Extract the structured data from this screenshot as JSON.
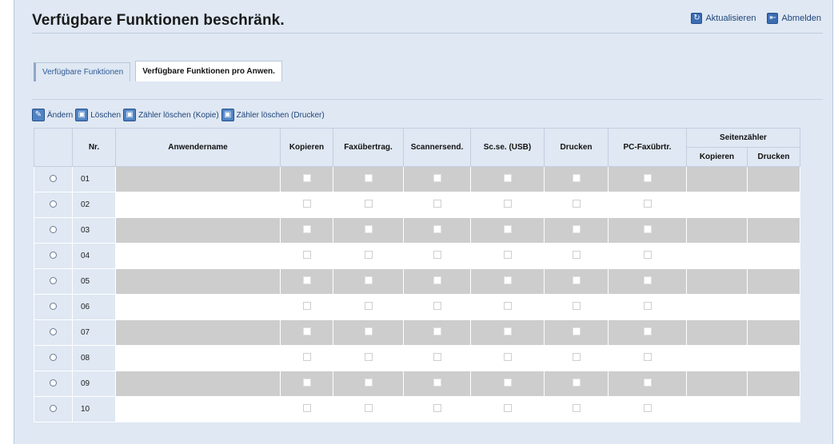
{
  "header": {
    "title": "Verfügbare Funktionen beschränk.",
    "refresh_label": "Aktualisieren",
    "logout_label": "Abmelden"
  },
  "tabs": [
    {
      "label": "Verfügbare Funktionen",
      "active": false
    },
    {
      "label": "Verfügbare Funktionen pro Anwen.",
      "active": true
    }
  ],
  "toolbar": {
    "edit_label": "Ändern",
    "delete_label": "Löschen",
    "clear_copy_label": "Zähler löschen (Kopie)",
    "clear_print_label": "Zähler löschen (Drucker)"
  },
  "table": {
    "headers": {
      "number": "Nr.",
      "user_name": "Anwendername",
      "copy": "Kopieren",
      "fax": "Faxübertrag.",
      "scanner": "Scannersend.",
      "scan_usb": "Sc.se. (USB)",
      "print": "Drucken",
      "pc_fax": "PC-Faxübrtr.",
      "page_counter": "Seitenzähler",
      "counter_copy": "Kopieren",
      "counter_print": "Drucken"
    },
    "rows": [
      {
        "number": "01"
      },
      {
        "number": "02"
      },
      {
        "number": "03"
      },
      {
        "number": "04"
      },
      {
        "number": "05"
      },
      {
        "number": "06"
      },
      {
        "number": "07"
      },
      {
        "number": "08"
      },
      {
        "number": "09"
      },
      {
        "number": "10"
      }
    ]
  },
  "colors": {
    "page_bg": "#dfe8f3",
    "row_shaded": "#cdcdcd",
    "link": "#20457a"
  }
}
